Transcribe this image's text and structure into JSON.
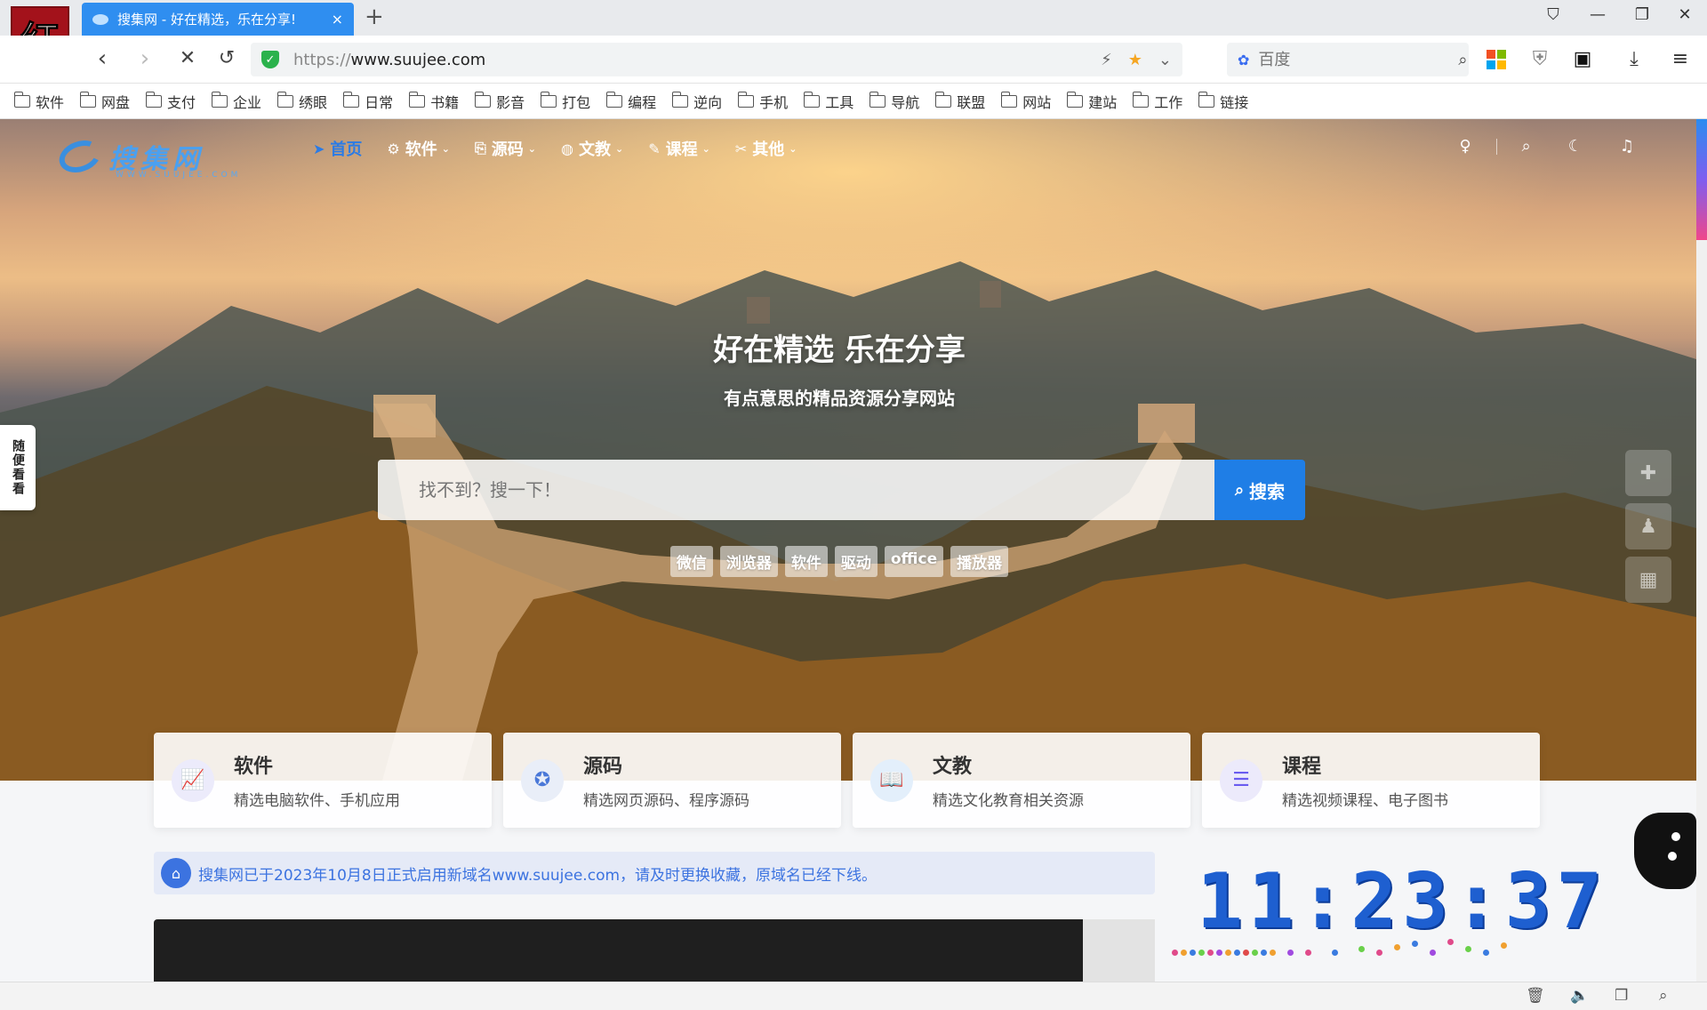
{
  "browser": {
    "profile_avatar": "红",
    "tab": {
      "title": "搜集网 - 好在精选，乐在分享!",
      "close": "×"
    },
    "new_tab": "+",
    "window_controls": {
      "shirt": "⛉",
      "minimize": "—",
      "restore": "❐",
      "close": "✕"
    },
    "nav": {
      "back": "‹",
      "forward": "›",
      "stop": "✕",
      "reload": "↺"
    },
    "address": {
      "scheme": "https://",
      "host": "www.suujee.com",
      "bolt": "⚡",
      "star": "★",
      "dropdown": "⌄"
    },
    "search_box": {
      "paw": "✿",
      "placeholder": "百度",
      "mag": "⌕"
    },
    "tool_icons": {
      "shield": "⛨",
      "ghost": "▣",
      "download": "⤓",
      "menu": "≡"
    },
    "bookmarks": [
      "软件",
      "网盘",
      "支付",
      "企业",
      "绣眼",
      "日常",
      "书籍",
      "影音",
      "打包",
      "编程",
      "逆向",
      "手机",
      "工具",
      "导航",
      "联盟",
      "网站",
      "建站",
      "工作",
      "链接"
    ]
  },
  "site": {
    "logo": {
      "text": "搜集网",
      "sub": "WWW.SUUJEE.COM"
    },
    "nav": [
      {
        "icon": "➤",
        "label": "首页",
        "chevron": ""
      },
      {
        "icon": "⚙",
        "label": "软件",
        "chevron": "⌄"
      },
      {
        "icon": "⎘",
        "label": "源码",
        "chevron": "⌄"
      },
      {
        "icon": "◍",
        "label": "文教",
        "chevron": "⌄"
      },
      {
        "icon": "✎",
        "label": "课程",
        "chevron": "⌄"
      },
      {
        "icon": "✂",
        "label": "其他",
        "chevron": "⌄"
      }
    ],
    "header_icons": {
      "bulb": "♀",
      "search": "⌕",
      "moon": "☾",
      "bell": "♫"
    },
    "hero": {
      "title": "好在精选 乐在分享",
      "subtitle": "有点意思的精品资源分享网站",
      "search_placeholder": "找不到？搜一下！",
      "search_button": "搜索",
      "search_icon": "⌕",
      "hot_tags": [
        "微信",
        "浏览器",
        "软件",
        "驱动",
        "office",
        "播放器"
      ]
    },
    "side_tab": "随便看看",
    "float_buttons": {
      "chat": "✚",
      "bell": "♟",
      "qr": "▦"
    },
    "cards": [
      {
        "icon": "📈",
        "title": "软件",
        "desc": "精选电脑软件、手机应用",
        "color": "#ecebfb"
      },
      {
        "icon": "✪",
        "title": "源码",
        "desc": "精选网页源码、程序源码",
        "color": "#e9eef8"
      },
      {
        "icon": "📖",
        "title": "文教",
        "desc": "精选文化教育相关资源",
        "color": "#e3effb"
      },
      {
        "icon": "☰",
        "title": "课程",
        "desc": "精选视频课程、电子图书",
        "color": "#eceafb"
      }
    ],
    "notice": {
      "icon": "⌂",
      "text": "搜集网已于2023年10月8日正式启用新域名www.suujee.com，请及时更换收藏，原域名已经下线。"
    },
    "clock": "11:23:37"
  },
  "statusbar": {
    "trash": "🗑",
    "sound": "🔈",
    "window": "❐",
    "zoom": "⌕"
  }
}
